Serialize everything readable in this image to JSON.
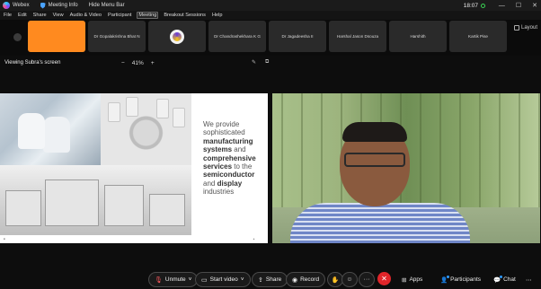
{
  "titlebar": {
    "app": "Webex",
    "meeting_info": "Meeting Info",
    "hide_menu": "Hide Menu Bar",
    "time": "18:07"
  },
  "menu": [
    "File",
    "Edit",
    "Share",
    "View",
    "Audio & Video",
    "Participant",
    "Meeting",
    "Breakout Sessions",
    "Help"
  ],
  "participants": [
    {
      "name": ""
    },
    {
      "name": "Dr Gopalakrishna Bhat N"
    },
    {
      "name": ""
    },
    {
      "name": "Dr Chandrashekhara K G"
    },
    {
      "name": "Dr Jagadeesha II"
    },
    {
      "name": "Harshal Jason Dsouza"
    },
    {
      "name": "Harshith"
    },
    {
      "name": "Kartik Pise"
    }
  ],
  "layout_label": "Layout",
  "viewbar": {
    "viewing": "Viewing Subra's screen",
    "zoom_minus": "−",
    "zoom": "41%",
    "zoom_plus": "+"
  },
  "slide": {
    "t1": "We provide sophisticated",
    "t2": "manufacturing systems",
    "t3": "and",
    "t4": "comprehensive services",
    "t5": "to the",
    "t6": "semiconductor",
    "t7": "and",
    "t8": "display",
    "t9": "industries"
  },
  "controls": {
    "unmute": "Unmute",
    "start_video": "Start video",
    "share": "Share",
    "record": "Record",
    "more": "···",
    "apps": "Apps",
    "participants": "Participants",
    "chat": "Chat"
  },
  "colors": {
    "accent_orange": "#ff8a1f",
    "end_red": "#e0252a",
    "badge_blue": "#2e9bff"
  }
}
